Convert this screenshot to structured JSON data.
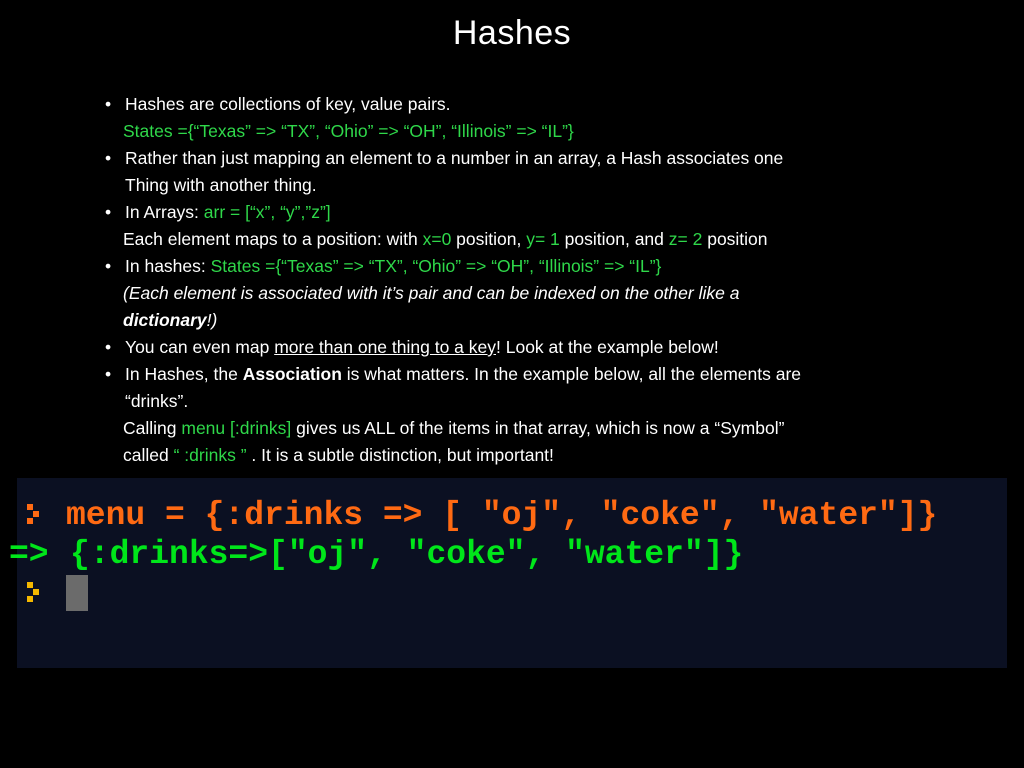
{
  "title": "Hashes",
  "bullets": {
    "b1": {
      "text": "Hashes are collections of key, value pairs.",
      "code": "States ={“Texas” => “TX”, “Ohio” => “OH”, “Illinois” => “IL”}"
    },
    "b2": {
      "line1": "Rather than just mapping an element to a number in an array, a Hash associates one",
      "line2": "Thing with another thing."
    },
    "b3": {
      "prefix": "In Arrays: ",
      "code": "arr = [“x”, “y”,”z”]",
      "sub_a": "Each element maps to a position:  with ",
      "x": "x=0",
      "sub_b": " position, ",
      "y": "y= 1",
      "sub_c": " position, and ",
      "z": "z= 2",
      "sub_d": " position"
    },
    "b4": {
      "prefix": "In hashes:  ",
      "code": "States ={“Texas” => “TX”, “Ohio” => “OH”, “Illinois” => “IL”}",
      "note1": "(Each element is associated with it’s pair and can be indexed on the other like a",
      "note_bold": "dictionary",
      "note_end": "!)"
    },
    "b5": {
      "prefix": "You can even map ",
      "underlined": "more than one thing to a key",
      "suffix": "! Look at the example below!"
    },
    "b6": {
      "prefix": "In Hashes, the ",
      "bold": "Association",
      "suffix": " is what matters. In the example below, all the elements are",
      "line2": "“drinks”.",
      "call_a": "Calling  ",
      "call_code": "menu [:drinks]",
      "call_b": "  gives us  ALL of the  items in that array, which is now a “Symbol”",
      "called_a": "called  ",
      "called_code": "“ :drinks ” ",
      "called_b": ". It is a subtle distinction, but important!"
    }
  },
  "terminal": {
    "input": "menu = {:drinks => [ \"oj\", \"coke\", \"water\"]}",
    "output_arrow": "=>",
    "output": "{:drinks=>[\"oj\", \"coke\", \"water\"]}",
    "colors": {
      "background": "#0b1022",
      "input": "#ff6a13",
      "output": "#00e61a",
      "prompt_active": "#f5b800"
    }
  }
}
